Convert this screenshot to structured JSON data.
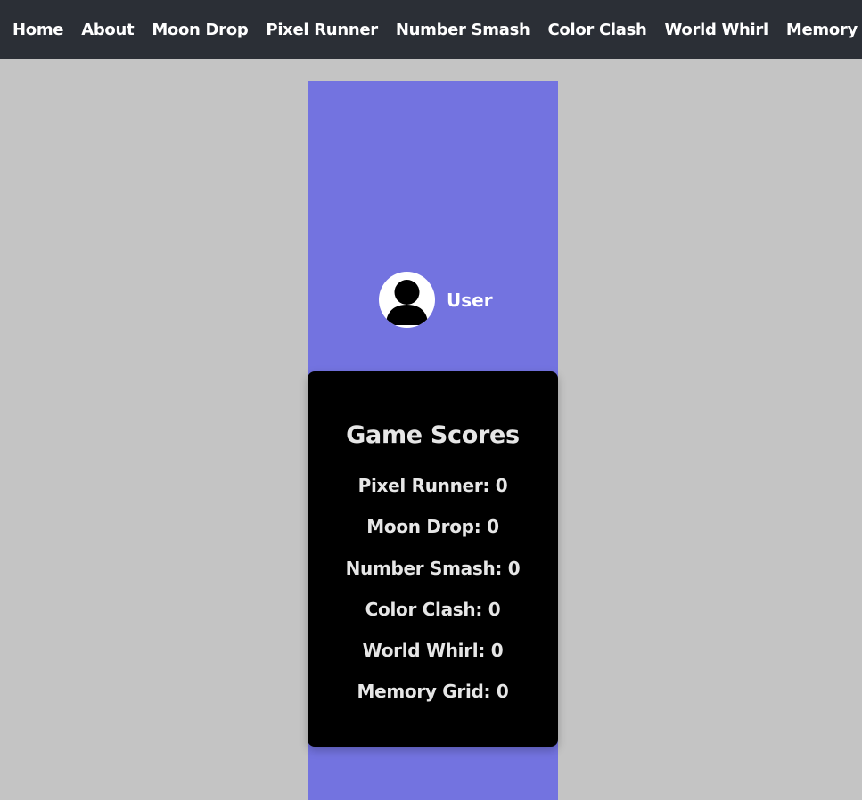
{
  "nav": {
    "items": [
      {
        "label": "Home"
      },
      {
        "label": "About"
      },
      {
        "label": "Moon Drop"
      },
      {
        "label": "Pixel Runner"
      },
      {
        "label": "Number Smash"
      },
      {
        "label": "Color Clash"
      },
      {
        "label": "World Whirl"
      },
      {
        "label": "Memory Grid"
      }
    ]
  },
  "user": {
    "name": "User",
    "avatar_icon": "user-silhouette-icon"
  },
  "scores": {
    "title": "Game Scores",
    "items": [
      {
        "text": "Pixel Runner: 0"
      },
      {
        "text": "Moon Drop: 0"
      },
      {
        "text": "Number Smash: 0"
      },
      {
        "text": "Color Clash: 0"
      },
      {
        "text": "World Whirl: 0"
      },
      {
        "text": "Memory Grid: 0"
      }
    ]
  },
  "colors": {
    "navbar": "#2b2f36",
    "page_bg": "#c4c4c4",
    "panel_bg": "#7373e0",
    "card_bg": "#000000"
  }
}
